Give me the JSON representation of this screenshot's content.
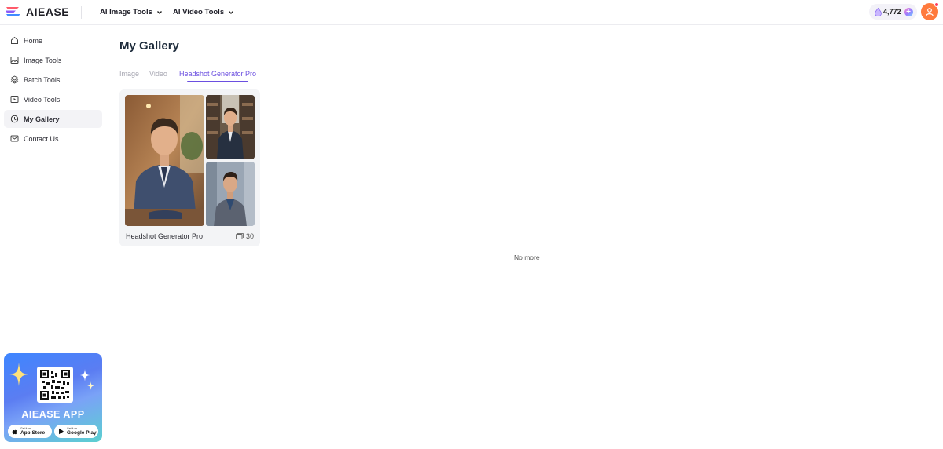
{
  "header": {
    "brand": "AIEASE",
    "nav": [
      {
        "label": "AI Image Tools"
      },
      {
        "label": "AI Video Tools"
      }
    ],
    "credits": "4,772"
  },
  "sidebar": {
    "items": [
      {
        "label": "Home",
        "icon": "home-icon"
      },
      {
        "label": "Image Tools",
        "icon": "image-icon"
      },
      {
        "label": "Batch Tools",
        "icon": "layers-icon"
      },
      {
        "label": "Video Tools",
        "icon": "video-icon"
      },
      {
        "label": "My Gallery",
        "icon": "history-icon",
        "active": true
      },
      {
        "label": "Contact Us",
        "icon": "mail-icon"
      }
    ],
    "promo": {
      "title": "AIEASE APP",
      "app_store_sub": "Get it on",
      "app_store": "App Store",
      "google_play_sub": "Get it on",
      "google_play": "Google Play"
    }
  },
  "main": {
    "title": "My Gallery",
    "tabs": [
      {
        "label": "Image"
      },
      {
        "label": "Video"
      },
      {
        "label": "Headshot Generator Pro",
        "active": true
      }
    ],
    "card": {
      "title": "Headshot Generator Pro",
      "count": "30"
    },
    "footer_text": "No more"
  },
  "colors": {
    "accent": "#6b4fe0",
    "avatar": "#ff7a3d"
  }
}
